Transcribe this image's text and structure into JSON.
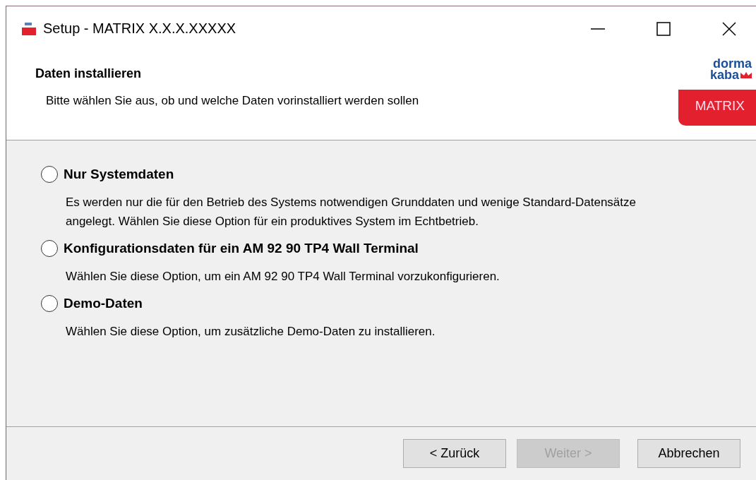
{
  "window": {
    "title": "Setup - MATRIX X.X.X.XXXXX"
  },
  "header": {
    "title": "Daten installieren",
    "subtitle": "Bitte wählen Sie aus, ob und welche Daten vorinstalliert werden sollen",
    "logo": {
      "line_1": "dorma",
      "line_2": "kaba"
    },
    "product_badge": "MATRIX"
  },
  "options": [
    {
      "label": "Nur Systemdaten",
      "description": "Es werden nur die für den Betrieb des Systems notwendigen Grunddaten und wenige Standard-Datensätze angelegt. Wählen Sie diese Option für ein produktives System im Echtbetrieb.",
      "selected": false
    },
    {
      "label": "Konfigurationsdaten für ein AM 92 90 TP4 Wall Terminal",
      "description": "Wählen Sie diese Option, um ein AM 92 90 TP4 Wall Terminal vorzukonfigurieren.",
      "selected": false
    },
    {
      "label": "Demo-Daten",
      "description": "Wählen Sie diese Option, um zusätzliche Demo-Daten zu installieren.",
      "selected": false
    }
  ],
  "buttons": [
    {
      "label": "< Zurück",
      "disabled": false
    },
    {
      "label": "Weiter >",
      "disabled": true
    },
    {
      "label": "Abbrechen",
      "disabled": false
    }
  ]
}
